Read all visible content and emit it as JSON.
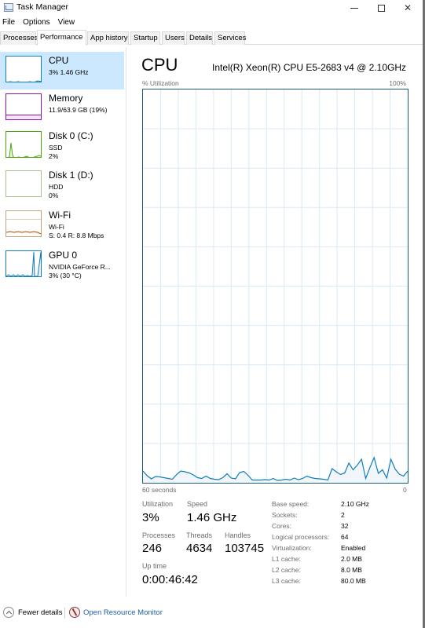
{
  "window": {
    "title": "Task Manager",
    "controls": {
      "minimize": "minimize",
      "maximize": "maximize",
      "close": "close"
    }
  },
  "menu": [
    "File",
    "Options",
    "View"
  ],
  "tabs": [
    {
      "label": "Processes",
      "active": false
    },
    {
      "label": "Performance",
      "active": true
    },
    {
      "label": "App history",
      "active": false
    },
    {
      "label": "Startup",
      "active": false
    },
    {
      "label": "Users",
      "active": false
    },
    {
      "label": "Details",
      "active": false
    },
    {
      "label": "Services",
      "active": false
    }
  ],
  "sidebar": [
    {
      "title": "CPU",
      "sub1": "3% 1.46 GHz",
      "sub2": "",
      "color": "#117dbb",
      "selected": true
    },
    {
      "title": "Memory",
      "sub1": "11.9/63.9 GB (19%)",
      "sub2": "",
      "color": "#8b12ae",
      "selected": false
    },
    {
      "title": "Disk 0 (C:)",
      "sub1": "SSD",
      "sub2": "2%",
      "color": "#4da60c",
      "selected": false
    },
    {
      "title": "Disk 1 (D:)",
      "sub1": "HDD",
      "sub2": "0%",
      "color": "#4da60c",
      "selected": false
    },
    {
      "title": "Wi-Fi",
      "sub1": "Wi-Fi",
      "sub2": "S: 0.4 R: 8.8 Mbps",
      "color": "#a74f01",
      "selected": false
    },
    {
      "title": "GPU 0",
      "sub1": "NVIDIA GeForce R...",
      "sub2": "3%  (30 °C)",
      "color": "#117dbb",
      "selected": false
    }
  ],
  "main": {
    "title": "CPU",
    "model": "Intel(R) Xeon(R) CPU E5-2683 v4 @ 2.10GHz",
    "y_label": "% Utilization",
    "y_max_label": "100%",
    "x_left_label": "60 seconds",
    "x_right_label": "0"
  },
  "chart_data": {
    "type": "area",
    "title": "CPU",
    "ylabel": "% Utilization",
    "xlabel": "60 seconds",
    "ylim": [
      0,
      100
    ],
    "xlim": [
      60,
      0
    ],
    "grid": true,
    "line_color": "#117dbb",
    "fill_color": "#f1f6fa",
    "values": [
      3.0,
      1.8,
      1.0,
      1.6,
      1.5,
      1.3,
      1.1,
      0.9,
      2.1,
      3.0,
      2.8,
      2.5,
      2.0,
      1.3,
      1.1,
      1.7,
      1.1,
      0.9,
      0.8,
      1.3,
      2.3,
      1.2,
      1.0,
      2.6,
      2.9,
      1.9,
      0.7,
      0.7,
      0.7,
      0.8,
      0.7,
      1.1,
      0.6,
      0.7,
      0.9,
      0.7,
      1.2,
      0.8,
      1.1,
      1.7,
      1.3,
      1.1,
      1.0,
      0.9,
      0.7,
      3.6,
      2.8,
      2.1,
      2.5,
      5.0,
      3.3,
      4.5,
      6.0,
      1.1,
      3.9,
      6.4,
      2.4,
      3.3,
      1.2,
      6.0,
      3.5,
      2.2,
      1.7,
      3.0
    ],
    "grid_rows": 10,
    "grid_cols": 15
  },
  "stats": {
    "utilization": {
      "label": "Utilization",
      "value": "3%"
    },
    "speed": {
      "label": "Speed",
      "value": "1.46 GHz"
    },
    "processes": {
      "label": "Processes",
      "value": "246"
    },
    "threads": {
      "label": "Threads",
      "value": "4634"
    },
    "handles": {
      "label": "Handles",
      "value": "103745"
    },
    "uptime": {
      "label": "Up time",
      "value": "0:00:46:42"
    }
  },
  "specs": [
    {
      "label": "Base speed:",
      "value": "2.10 GHz"
    },
    {
      "label": "Sockets:",
      "value": "2"
    },
    {
      "label": "Cores:",
      "value": "32"
    },
    {
      "label": "Logical processors:",
      "value": "64"
    },
    {
      "label": "Virtualization:",
      "value": "Enabled"
    },
    {
      "label": "L1 cache:",
      "value": "2.0 MB"
    },
    {
      "label": "L2 cache:",
      "value": "8.0 MB"
    },
    {
      "label": "L3 cache:",
      "value": "80.0 MB"
    }
  ],
  "footer": {
    "fewer_details": "Fewer details",
    "open_resource_monitor": "Open Resource Monitor"
  }
}
